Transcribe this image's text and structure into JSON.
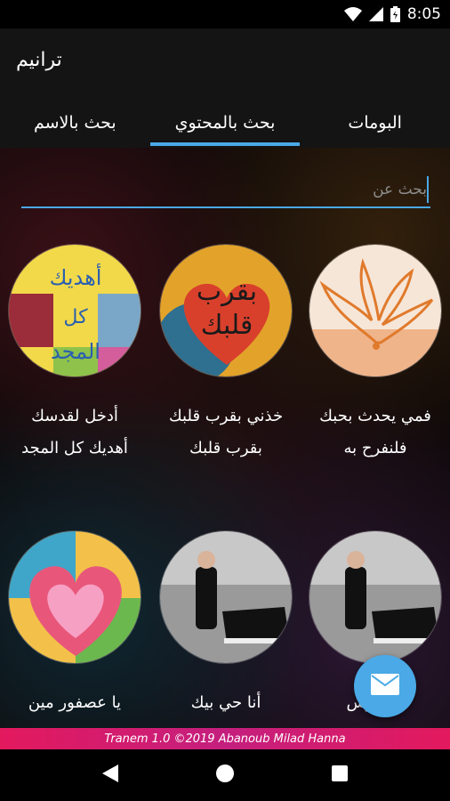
{
  "status_bar": {
    "time": "8:05",
    "icons": [
      "wifi-icon",
      "signal-icon",
      "battery-icon"
    ]
  },
  "app": {
    "title": "ترانيم"
  },
  "tabs": [
    {
      "label": "البومات",
      "active": false
    },
    {
      "label": "بحث بالمحتوي",
      "active": true
    },
    {
      "label": "بحث بالاسم",
      "active": false
    }
  ],
  "search": {
    "placeholder": "بحث عن",
    "value": ""
  },
  "cards": [
    {
      "title": "فمي يحدث بحبك",
      "subtitle": "فلنفرح به",
      "cover": "dove-cover"
    },
    {
      "title": "خذني بقرب قلبك",
      "subtitle": "بقرب قلبك",
      "cover": "heart-yellow-cover",
      "cover_text": [
        "بقرب",
        "قلبك"
      ]
    },
    {
      "title": "أدخل لقدسك",
      "subtitle": "أهديك كل المجد",
      "cover": "collage-cover",
      "cover_text": [
        "أهديك",
        "كل",
        "المجد"
      ]
    },
    {
      "title": "يا قدوس",
      "subtitle": "",
      "cover": "piano-man-cover"
    },
    {
      "title": "أنا حي بيك",
      "subtitle": "",
      "cover": "piano-man-cover"
    },
    {
      "title": "يا عصفور مين",
      "subtitle": "",
      "cover": "painted-heart-cover"
    }
  ],
  "footer": {
    "text": "Tranem 1.0 ©2019 Abanoub Milad Hanna"
  },
  "colors": {
    "accent": "#4aa9e6",
    "footer": "#e3195d",
    "app_bar": "#141414"
  }
}
